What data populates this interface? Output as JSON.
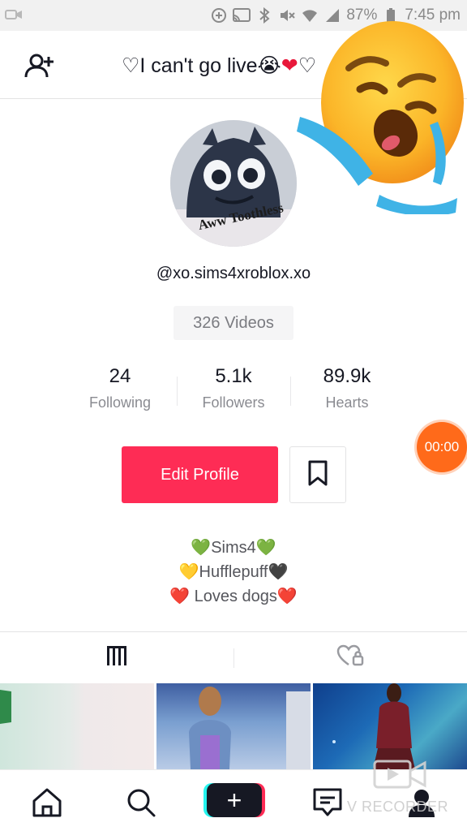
{
  "status_bar": {
    "battery": "87%",
    "time": "7:45 pm"
  },
  "header": {
    "title_prefix": "♡I can't go live",
    "title_emoji1": "😭",
    "title_heart": "❤",
    "title_suffix": "♡",
    "add_user_icon": "add-user-icon"
  },
  "sticker": {
    "emoji": "crying-face-emoji"
  },
  "profile": {
    "username": "@xo.sims4xroblox.xo",
    "avatar_caption": "Aww Toothless",
    "videos": "326 Videos",
    "stats": [
      {
        "value": "24",
        "label": "Following"
      },
      {
        "value": "5.1k",
        "label": "Followers"
      },
      {
        "value": "89.9k",
        "label": "Hearts"
      }
    ],
    "edit_profile_label": "Edit Profile",
    "bio": [
      "💚Sims4💚",
      "💛Hufflepuff🖤",
      "❤️ Loves dogs❤️"
    ]
  },
  "recorder": {
    "timer": "00:00",
    "watermark": "V RECORDER"
  },
  "colors": {
    "accent": "#fe2c55",
    "record": "#ff6a1a"
  }
}
